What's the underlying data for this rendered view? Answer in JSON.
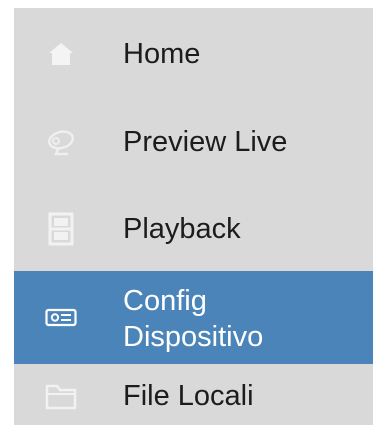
{
  "menu": {
    "items": [
      {
        "id": "home",
        "label": "Home",
        "icon": "home-icon",
        "selected": false
      },
      {
        "id": "preview",
        "label": "Preview Live",
        "icon": "camera-icon",
        "selected": false
      },
      {
        "id": "playback",
        "label": "Playback",
        "icon": "playback-icon",
        "selected": false
      },
      {
        "id": "config",
        "label": "Config Dispositivo",
        "icon": "device-icon",
        "selected": true
      },
      {
        "id": "files",
        "label": "File Locali",
        "icon": "folder-icon",
        "selected": false
      }
    ]
  },
  "colors": {
    "drawer_background": "#d9d9d9",
    "selected_background": "#4b84b8",
    "label_text": "#1c1c1c",
    "selected_text": "#ffffff",
    "icon_muted": "#efefef"
  }
}
